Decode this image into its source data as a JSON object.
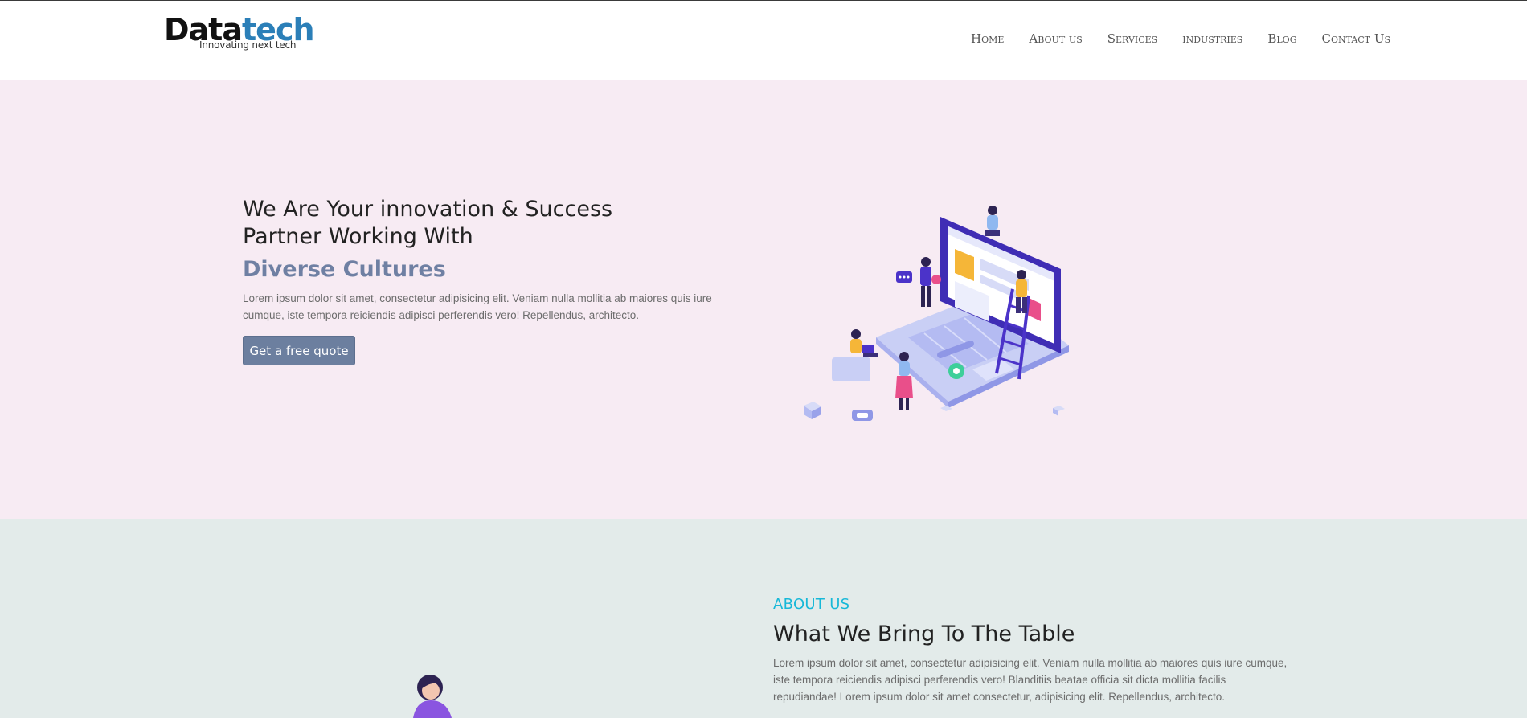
{
  "brand": {
    "name_part1": "Data",
    "name_part2": "tech",
    "tagline": "Innovating next tech",
    "color_dark": "#111111",
    "color_blue": "#2b7fb8"
  },
  "nav": {
    "items": [
      "Home",
      "About us",
      "Services",
      "industries",
      "Blog",
      "Contact Us"
    ]
  },
  "hero": {
    "title": "We Are Your innovation & Success Partner Working With",
    "accent": "Diverse Cultures",
    "text": "Lorem ipsum dolor sit amet, consectetur adipisicing elit. Veniam nulla mollitia ab maiores quis iure cumque, iste tempora reiciendis adipisci perferendis vero! Repellendus, architecto.",
    "cta_label": "Get a free quote",
    "background": "#f7ebf3",
    "accent_color": "#6f80a3",
    "illustration": "team-building-website-on-laptop-illustration"
  },
  "about": {
    "kicker": "ABOUT US",
    "title": "What We Bring To The Table",
    "text": "Lorem ipsum dolor sit amet, consectetur adipisicing elit. Veniam nulla mollitia ab maiores quis iure cumque, iste tempora reiciendis adipisci perferendis vero! Blanditiis beatae officia sit dicta mollitia facilis repudiandae! Lorem ipsum dolor sit amet consectetur, adipisicing elit. Repellendus, architecto.",
    "background": "#e3ebea",
    "kicker_color": "#17b8d8",
    "illustration": "person-illustration"
  }
}
